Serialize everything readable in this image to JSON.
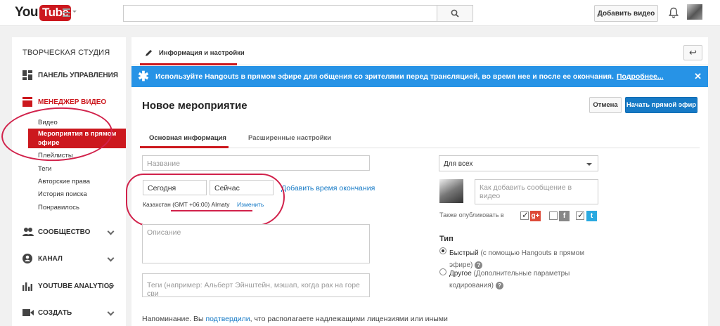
{
  "topbar": {
    "logo_you": "You",
    "logo_tube": "Tube",
    "upload_label": "Добавить видео"
  },
  "sidebar": {
    "studio_title": "ТВОРЧЕСКАЯ СТУДИЯ",
    "dashboard": "ПАНЕЛЬ УПРАВЛЕНИЯ",
    "video_manager": "МЕНЕДЖЕР ВИДЕО",
    "sub_items": [
      "Видео",
      "Мероприятия в прямом эфире",
      "Плейлисты",
      "Теги",
      "Авторские права",
      "История поиска",
      "Понравилось"
    ],
    "community": "СООБЩЕСТВО",
    "channel": "КАНАЛ",
    "analytics": "YOUTUBE ANALYTICS",
    "create": "СОЗДАТЬ"
  },
  "main": {
    "tab_label": "Информация и настройки",
    "banner_text": "Используйте Hangouts в прямом эфире для общения со зрителями перед трансляцией, во время нее и после ее окончания.",
    "banner_more": "Подробнее...",
    "page_title": "Новое мероприятие",
    "cancel_label": "Отмена",
    "golive_label": "Начать прямой эфир",
    "subtab_basic": "Основная информация",
    "subtab_advanced": "Расширенные настройки",
    "title_placeholder": "Название",
    "date_value": "Сегодня",
    "time_value": "Сейчас",
    "add_end_time": "Добавить время окончания",
    "timezone": "Казахстан (GMT +06:00) Almaty",
    "change_link": "Изменить",
    "description_placeholder": "Описание",
    "tags_placeholder": "Теги (например: Альберт Эйнштейн, мэшап, когда рак на горе сви",
    "reminder_prefix": "Напоминание. Вы",
    "reminder_link": "подтвердили",
    "reminder_suffix": ", что располагаете надлежащими лицензиями или иными"
  },
  "right": {
    "privacy_value": "Для всех",
    "message_placeholder": "Как добавить сообщение в видео",
    "also_publish": "Также опубликовать в",
    "type_heading": "Тип",
    "type_fast_label": "Быстрый",
    "type_fast_desc_1": "(с помощью Hangouts в прямом",
    "type_fast_desc_2": "эфире)",
    "type_other_label": "Другое",
    "type_other_desc_1": "(Дополнительные параметры",
    "type_other_desc_2": "кодирования)"
  },
  "colors": {
    "youtube_red": "#cc181e",
    "banner_blue": "#2793e6",
    "button_blue": "#167ac6",
    "annotation": "#d1224b"
  },
  "icons": [
    "guide-menu-icon",
    "search-icon",
    "bell-icon",
    "dashboard-icon",
    "video-manager-icon",
    "community-icon",
    "channel-icon",
    "analytics-icon",
    "create-icon",
    "pencil-icon",
    "back-arrow-icon",
    "star-icon",
    "close-icon",
    "google-plus-icon",
    "facebook-icon",
    "twitter-icon",
    "help-icon"
  ]
}
